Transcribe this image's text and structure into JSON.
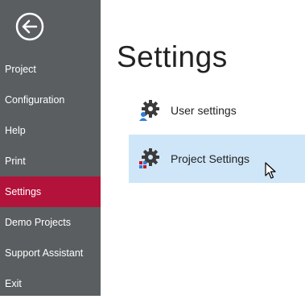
{
  "sidebar": {
    "back_icon": "arrow-left-circle-icon",
    "items": [
      {
        "label": "Project",
        "active": false
      },
      {
        "label": "Configuration",
        "active": false
      },
      {
        "label": "Help",
        "active": false
      },
      {
        "label": "Print",
        "active": false
      },
      {
        "label": "Settings",
        "active": true
      },
      {
        "label": "Demo Projects",
        "active": false
      },
      {
        "label": "Support Assistant",
        "active": false
      },
      {
        "label": "Exit",
        "active": false
      }
    ]
  },
  "main": {
    "title": "Settings",
    "options": [
      {
        "label": "User settings",
        "icon": "user-settings-gear-icon",
        "highlighted": false
      },
      {
        "label": "Project Settings",
        "icon": "project-settings-gear-icon",
        "highlighted": true
      }
    ]
  },
  "colors": {
    "sidebar_bg": "#5a5e61",
    "active_item": "#b3123b",
    "hover_bg": "#cfe6f8",
    "text": "#222222"
  }
}
